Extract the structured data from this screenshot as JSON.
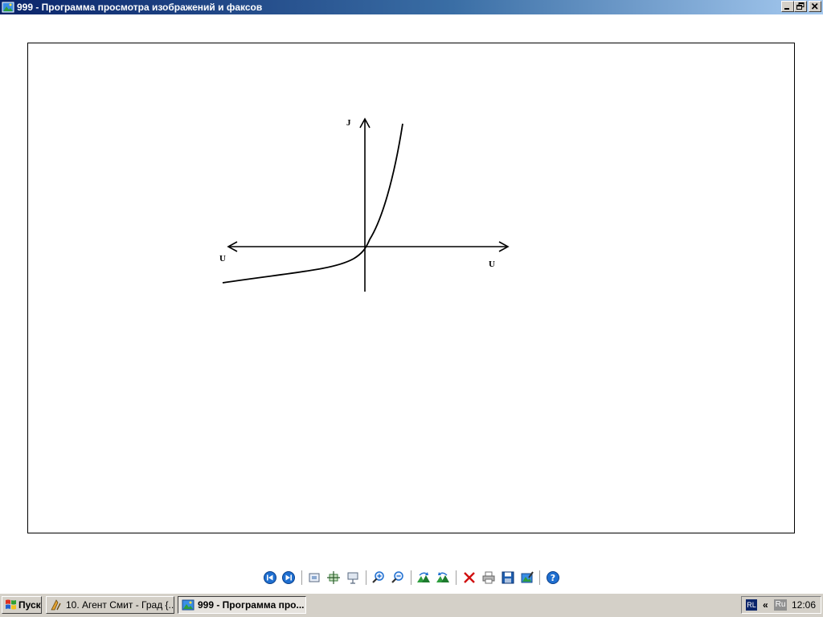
{
  "window": {
    "title": "999 - Программа просмотра изображений и факсов"
  },
  "image": {
    "y_axis_label": "J",
    "x_axis_label_left": "U",
    "x_axis_label_right": "U"
  },
  "toolbar": {
    "buttons": [
      {
        "icon": "previous-image-icon"
      },
      {
        "icon": "next-image-icon"
      },
      {
        "icon": "best-fit-icon"
      },
      {
        "icon": "actual-size-icon"
      },
      {
        "icon": "slideshow-icon"
      },
      {
        "icon": "zoom-in-icon"
      },
      {
        "icon": "zoom-out-icon"
      },
      {
        "icon": "rotate-clockwise-icon"
      },
      {
        "icon": "rotate-counterclockwise-icon"
      },
      {
        "icon": "delete-icon"
      },
      {
        "icon": "print-icon"
      },
      {
        "icon": "save-icon"
      },
      {
        "icon": "edit-icon"
      },
      {
        "icon": "help-icon"
      }
    ]
  },
  "taskbar": {
    "start_label": "Пуск",
    "tasks": [
      {
        "label": "10. Агент Смит - Град {...",
        "active": false
      },
      {
        "label": "999 - Программа про...",
        "active": true
      }
    ],
    "tray": {
      "lang_indicator": "RL",
      "chevron": "«",
      "lang_ru": "Ru",
      "clock": "12:06"
    }
  },
  "colors": {
    "titlebar_start": "#0a246a",
    "titlebar_end": "#a6caf0",
    "taskbar": "#d4d0c8",
    "toolbar_blue": "#1f6fd0",
    "delete_red": "#d01010"
  }
}
